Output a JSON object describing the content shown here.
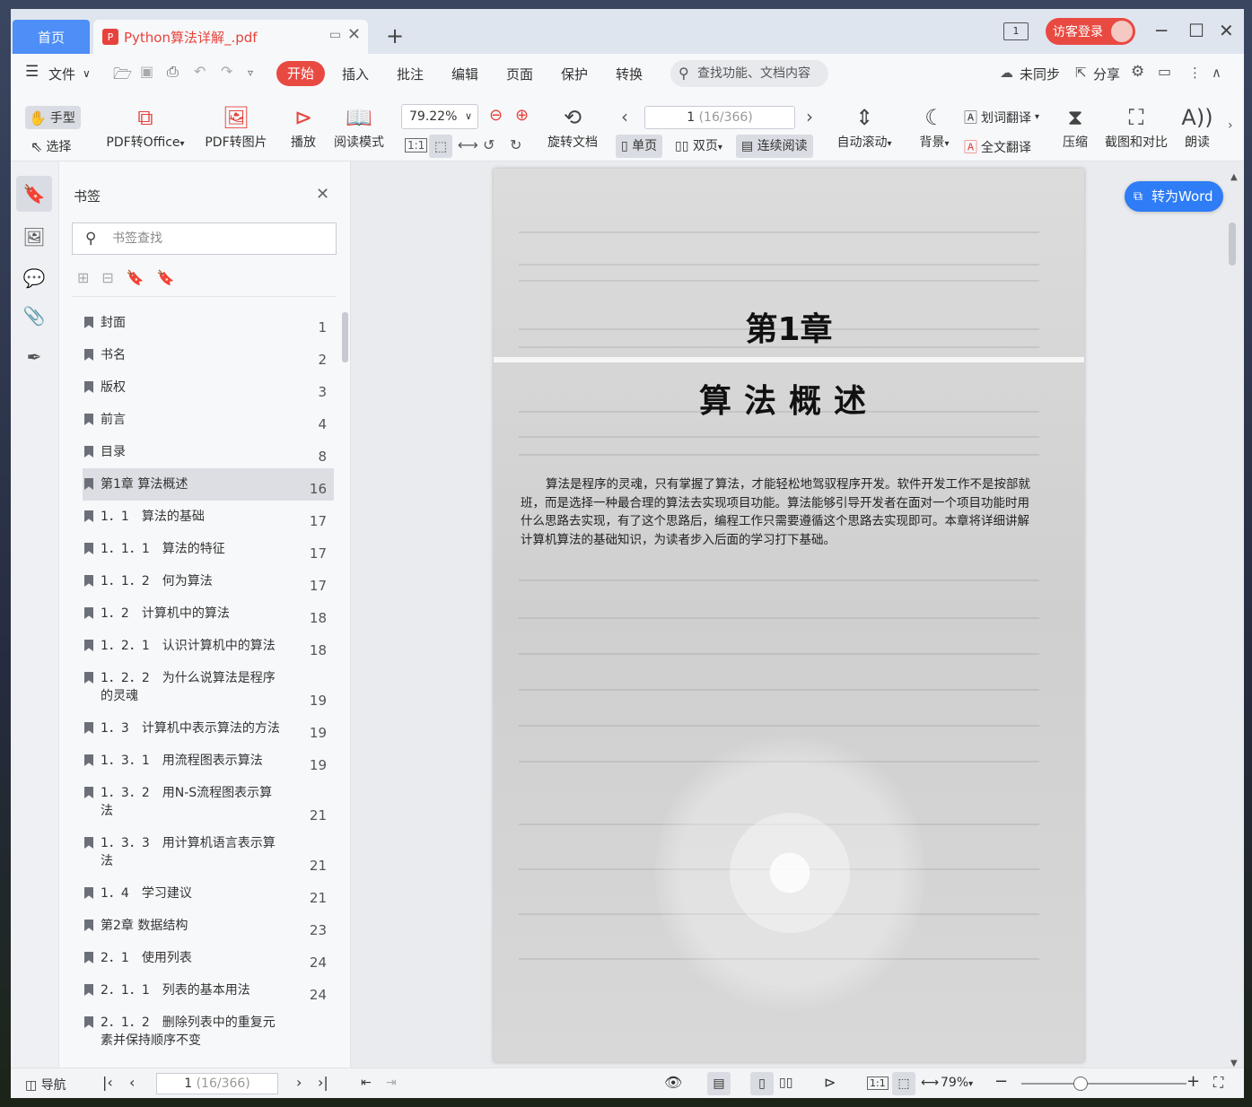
{
  "tabs": {
    "home": "首页",
    "doc": "Python算法详解_.pdf",
    "doc_icon": "pdf-icon"
  },
  "titlebar": {
    "page_badge": "1",
    "login": "访客登录"
  },
  "menu": {
    "file": "文件",
    "items": [
      "开始",
      "插入",
      "批注",
      "编辑",
      "页面",
      "保护",
      "转换"
    ],
    "active": "开始",
    "search": "查找功能、文档内容",
    "sync": "未同步",
    "share": "分享"
  },
  "toolbar": {
    "hand": "手型",
    "select": "选择",
    "pdf_office": "PDF转Office",
    "pdf_image": "PDF转图片",
    "play": "播放",
    "read_mode": "阅读模式",
    "zoom": "79.22%",
    "rotate": "旋转文档",
    "page_current": "1",
    "page_total": "(16/366)",
    "single": "单页",
    "double": "双页",
    "continuous": "连续阅读",
    "autoscroll": "自动滚动",
    "background": "背景",
    "word_translate": "划词翻译",
    "full_translate": "全文翻译",
    "compress": "压缩",
    "screenshot": "截图和对比",
    "read_aloud": "朗读"
  },
  "bookmarks": {
    "title": "书签",
    "search_placeholder": "书签查找",
    "items": [
      {
        "label": "封面",
        "page": "1"
      },
      {
        "label": "书名",
        "page": "2"
      },
      {
        "label": "版权",
        "page": "3"
      },
      {
        "label": "前言",
        "page": "4"
      },
      {
        "label": "目录",
        "page": "8"
      },
      {
        "label": "第1章 算法概述",
        "page": "16",
        "selected": true
      },
      {
        "label": "1．1　算法的基础",
        "page": "17"
      },
      {
        "label": "1．1．1　算法的特征",
        "page": "17"
      },
      {
        "label": "1．1．2　何为算法",
        "page": "17"
      },
      {
        "label": "1．2　计算机中的算法",
        "page": "18"
      },
      {
        "label": "1．2．1　认识计算机中的算法",
        "page": "18"
      },
      {
        "label": "1．2．2　为什么说算法是程序的灵魂",
        "page": "19"
      },
      {
        "label": "1．3　计算机中表示算法的方法",
        "page": "19"
      },
      {
        "label": "1．3．1　用流程图表示算法",
        "page": "19"
      },
      {
        "label": "1．3．2　用N-S流程图表示算法",
        "page": "21"
      },
      {
        "label": "1．3．3　用计算机语言表示算法",
        "page": "21"
      },
      {
        "label": "1．4　学习建议",
        "page": "21"
      },
      {
        "label": "第2章 数据结构",
        "page": "23"
      },
      {
        "label": "2．1　使用列表",
        "page": "24"
      },
      {
        "label": "2．1．1　列表的基本用法",
        "page": "24"
      },
      {
        "label": "2．1．2　删除列表中的重复元素并保持顺序不变",
        "page": ""
      }
    ]
  },
  "document": {
    "chapter_no": "第1章",
    "chapter_title": "算法概述",
    "intro": "算法是程序的灵魂，只有掌握了算法，才能轻松地驾驭程序开发。软件开发工作不是按部就班，而是选择一种最合理的算法去实现项目功能。算法能够引导开发者在面对一个项目功能时用什么思路去实现，有了这个思路后，编程工作只需要遵循这个思路去实现即可。本章将详细讲解计算机算法的基础知识，为读者步入后面的学习打下基础。"
  },
  "to_word": "转为Word",
  "status": {
    "nav": "导航",
    "page_current": "1",
    "page_total": "(16/366)",
    "zoom": "79%"
  }
}
